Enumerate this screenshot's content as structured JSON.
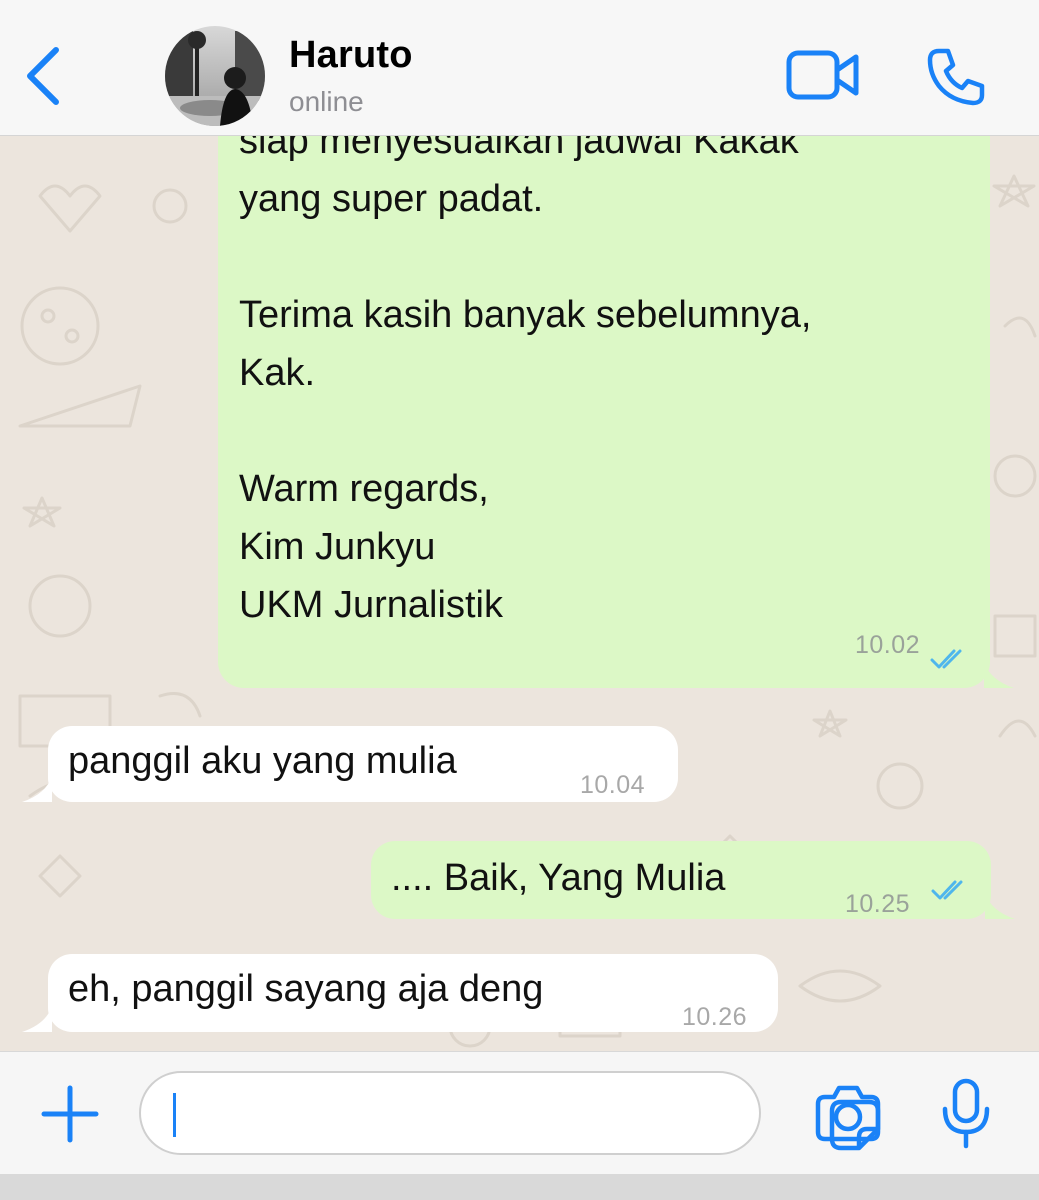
{
  "header": {
    "contact_name": "Haruto",
    "status": "online",
    "icons": {
      "back": "chevron-left-icon",
      "video": "video-camera-icon",
      "call": "phone-icon"
    }
  },
  "messages": [
    {
      "direction": "outgoing",
      "lines": [
        "siap menyesuaikan jadwal Kakak",
        "yang super padat.",
        "",
        "Terima kasih banyak sebelumnya,",
        "Kak.",
        "",
        "Warm regards,",
        "Kim Junkyu",
        "UKM Jurnalistik"
      ],
      "time": "10.02",
      "status": "read"
    },
    {
      "direction": "incoming",
      "lines": [
        "panggil aku yang mulia"
      ],
      "time": "10.04"
    },
    {
      "direction": "outgoing",
      "lines": [
        ".... Baik, Yang Mulia"
      ],
      "time": "10.25",
      "status": "read"
    },
    {
      "direction": "incoming",
      "lines": [
        "eh, panggil sayang aja deng"
      ],
      "time": "10.26"
    }
  ],
  "composer": {
    "value": "",
    "placeholder": "",
    "icons": {
      "attach": "plus-icon",
      "sticker": "sticker-icon",
      "camera": "camera-icon",
      "mic": "microphone-icon"
    }
  },
  "colors": {
    "accent": "#1a82f7",
    "outgoing_bubble": "#dcf8c6",
    "incoming_bubble": "#ffffff",
    "chat_background": "#ece5dd",
    "read_ticks": "#4fb6ec"
  }
}
